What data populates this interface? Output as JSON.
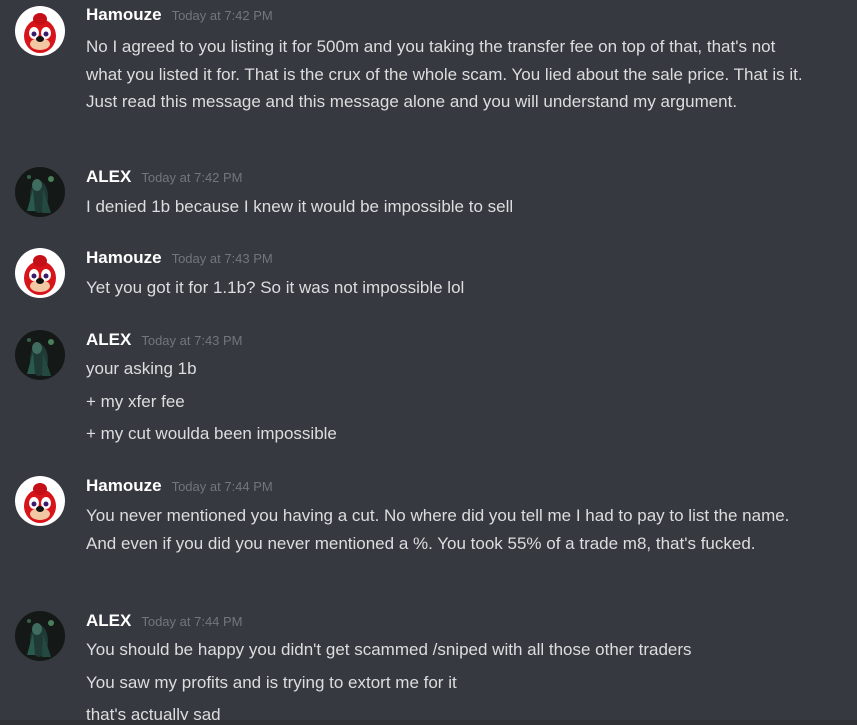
{
  "messages": [
    {
      "author": "Hamouze",
      "timestamp": "Today at 7:42 PM",
      "avatar_icon": "ugandan-knuckles-avatar-icon",
      "lines": [
        "No I agreed to you listing it for 500m and you taking the transfer fee on top of that, that's not what you listed it for. That is the crux of the whole scam. You lied about the sale price. That is it. Just read this message and this message alone and you will understand my argument."
      ]
    },
    {
      "author": "ALEX",
      "timestamp": "Today at 7:42 PM",
      "avatar_icon": "dark-figure-avatar-icon",
      "lines": [
        "I denied 1b because I knew it would be impossible to sell"
      ]
    },
    {
      "author": "Hamouze",
      "timestamp": "Today at 7:43 PM",
      "avatar_icon": "ugandan-knuckles-avatar-icon",
      "lines": [
        "Yet you got it for 1.1b? So it was not impossible lol"
      ]
    },
    {
      "author": "ALEX",
      "timestamp": "Today at 7:43 PM",
      "avatar_icon": "dark-figure-avatar-icon",
      "lines": [
        "your asking 1b",
        "+ my xfer fee",
        "+ my cut woulda been impossible"
      ]
    },
    {
      "author": "Hamouze",
      "timestamp": "Today at 7:44 PM",
      "avatar_icon": "ugandan-knuckles-avatar-icon",
      "lines": [
        "You never mentioned you having a cut. No where did you tell me I had to pay to list the name. And even if you did you never mentioned a %. You took 55% of a trade m8, that's fucked."
      ]
    },
    {
      "author": "ALEX",
      "timestamp": "Today at 7:44 PM",
      "avatar_icon": "dark-figure-avatar-icon",
      "lines": [
        "You should be happy you didn't get scammed /sniped with all those other traders",
        "You saw my profits and is trying to extort me for it",
        "that's actually sad"
      ]
    }
  ],
  "colors": {
    "background": "#36393f",
    "username": "#ffffff",
    "text": "#dcddde",
    "timestamp": "#72767d"
  }
}
